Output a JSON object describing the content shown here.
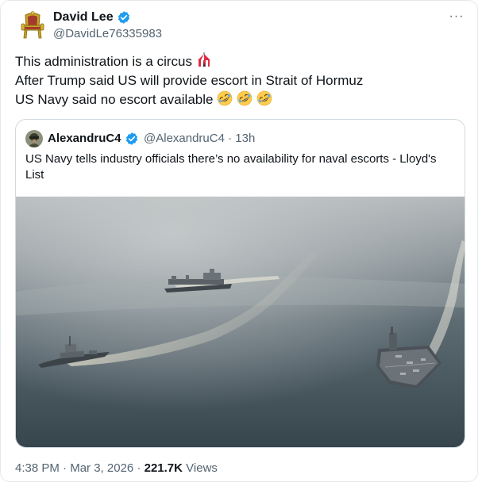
{
  "tweet": {
    "author_name": "David Lee",
    "author_handle": "@DavidLe76335983",
    "more_glyph": "···",
    "lines": [
      "This administration is a circus",
      "After Trump said US will provide escort in Strait of Hormuz",
      "US Navy said no escort available"
    ],
    "line1_emoji": "circus-tent-emoji",
    "line3_emoji": "rolling-on-floor-laughing-emoji",
    "line3_emoji_count": 3
  },
  "quote": {
    "author_name": "AlexandruC4",
    "author_handle": "@AlexandruC4",
    "separator": "·",
    "time_ago": "13h",
    "text": "US Navy tells industry officials there’s no availability for naval escorts - Lloyd's List"
  },
  "footer": {
    "time": "4:38 PM",
    "date": "Mar 3, 2026",
    "separator": "·",
    "views_count": "221.7K",
    "views_label": "Views"
  },
  "colors": {
    "text_primary": "#0f1419",
    "text_secondary": "#536471",
    "verified_blue": "#1d9bf0",
    "border": "#cfd9de"
  },
  "icons": {
    "verified": "verified-badge-icon",
    "more": "more-options-icon"
  }
}
